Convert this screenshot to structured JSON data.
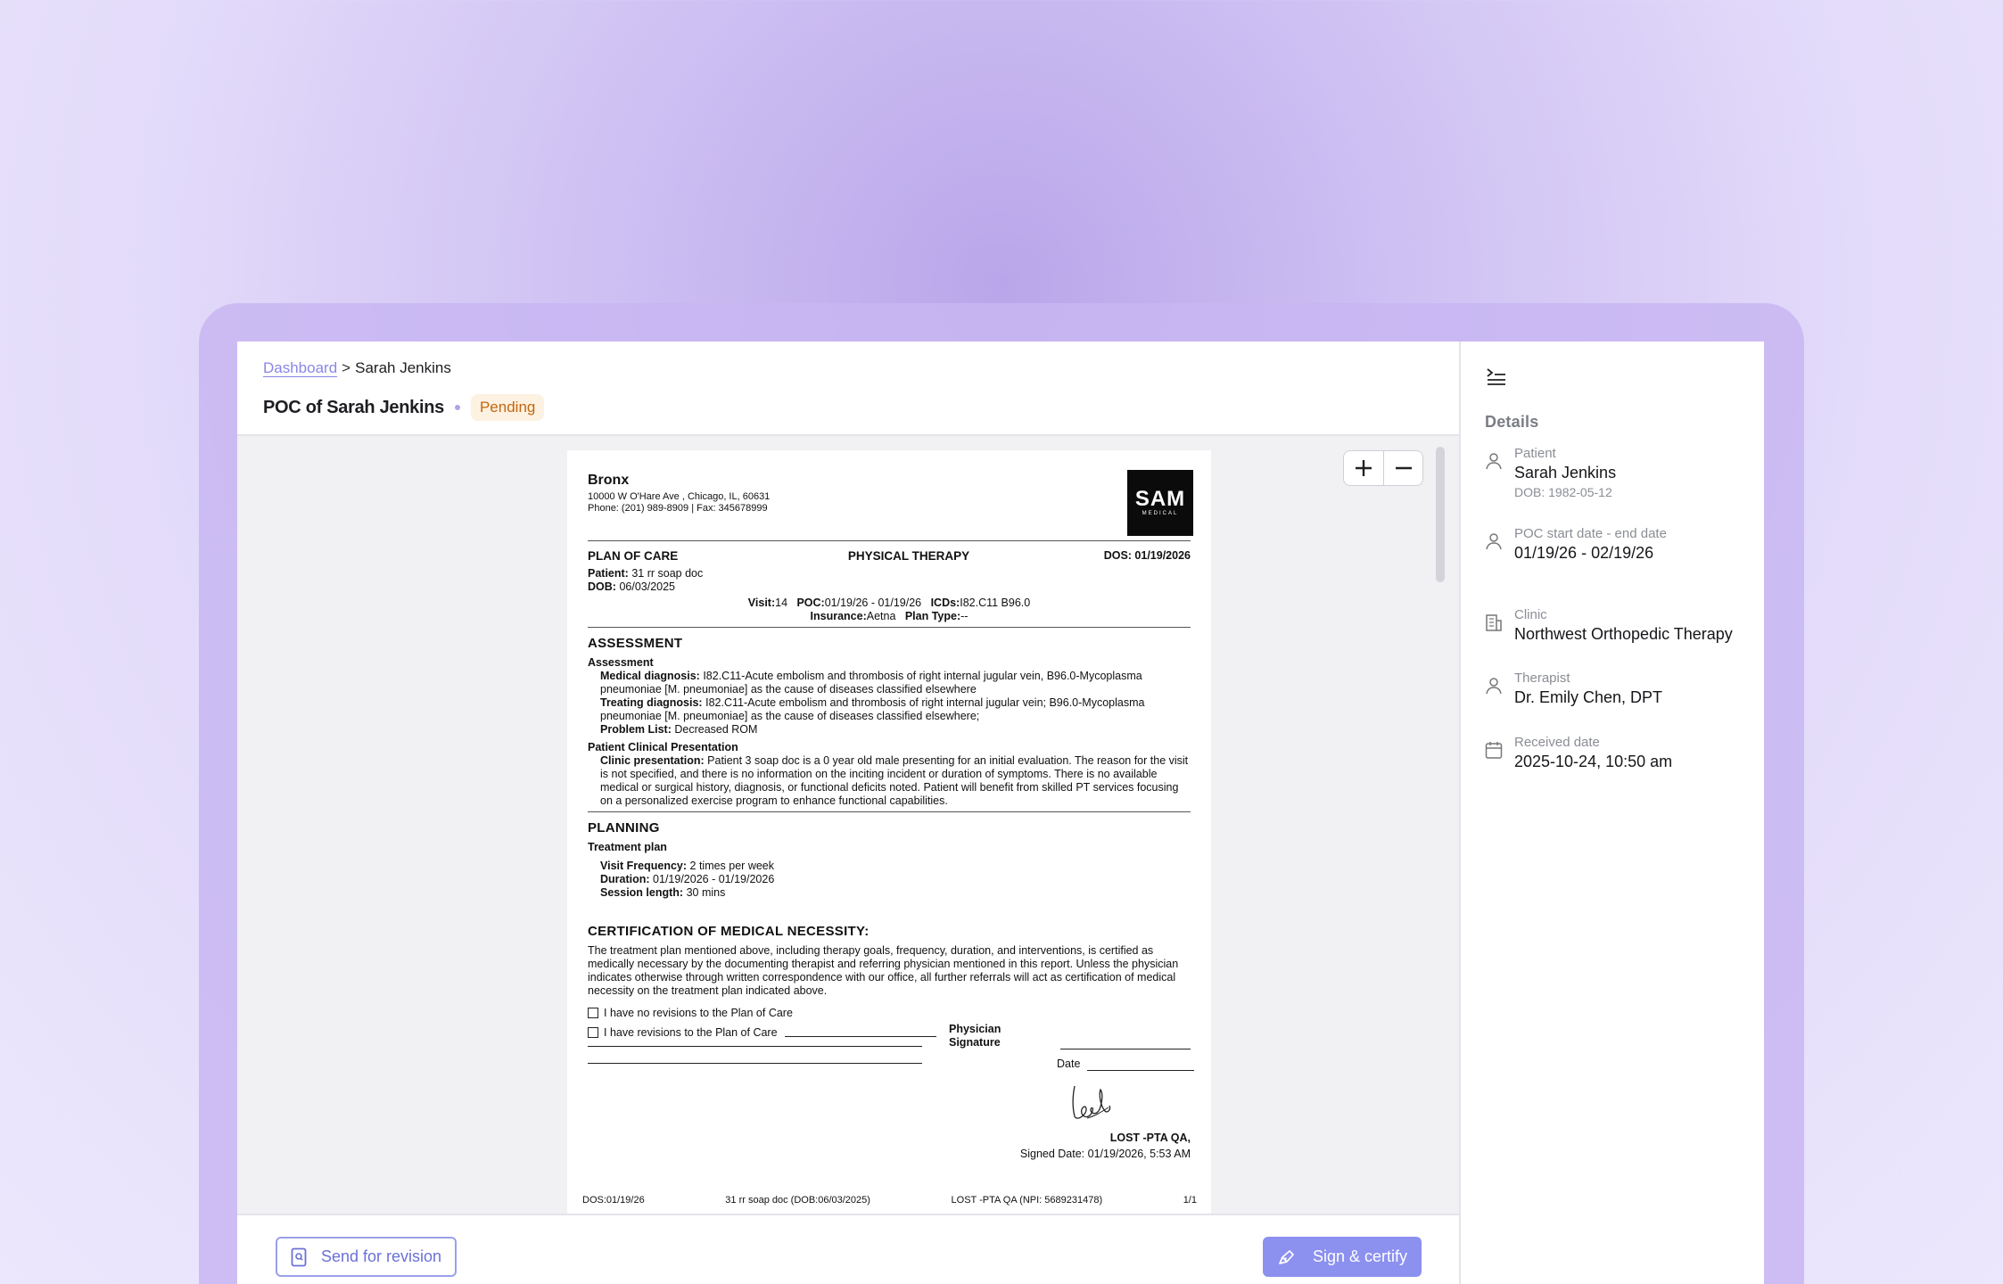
{
  "breadcrumb": {
    "link": "Dashboard",
    "separator": ">",
    "current": "Sarah Jenkins"
  },
  "header": {
    "title": "POC of Sarah Jenkins",
    "status": "Pending"
  },
  "zoom": {
    "in": "+",
    "out": "−"
  },
  "document": {
    "clinic_name": "Bronx",
    "address": "10000 W O'Hare Ave , Chicago, IL, 60631",
    "phone": "Phone: (201) 989-8909 | Fax: 345678999",
    "logo_main": "SAM",
    "logo_sub": "MEDICAL",
    "doc_type": "PLAN OF CARE",
    "discipline": "PHYSICAL THERAPY",
    "dos": "DOS: 01/19/2026",
    "patient_label": "Patient:",
    "patient_value": "31 rr soap doc",
    "dob_label": "DOB:",
    "dob_value": "06/03/2025",
    "visit_label": "Visit:",
    "visit_value": "14",
    "poc_label": "POC:",
    "poc_value": "01/19/26 - 01/19/26",
    "icds_label": "ICDs:",
    "icds_value": "I82.C11 B96.0",
    "insurance_label": "Insurance:",
    "insurance_value": "Aetna",
    "plan_type_label": "Plan Type:",
    "plan_type_value": "--",
    "assessment_section": "ASSESSMENT",
    "assessment_sub": "Assessment",
    "medical_dx_label": "Medical diagnosis:",
    "medical_dx_value": "I82.C11-Acute embolism and thrombosis of right internal jugular vein, B96.0-Mycoplasma pneumoniae [M. pneumoniae] as the cause of diseases classified elsewhere",
    "treating_dx_label": "Treating diagnosis:",
    "treating_dx_value": "I82.C11-Acute embolism and thrombosis of right internal jugular vein; B96.0-Mycoplasma pneumoniae [M. pneumoniae] as the cause of diseases classified elsewhere;",
    "problem_list_label": "Problem List:",
    "problem_list_value": "Decreased ROM",
    "clinical_presentation_sub": "Patient Clinical Presentation",
    "clinic_presentation_label": "Clinic presentation:",
    "clinic_presentation_value": "Patient 3 soap doc is a 0 year old male presenting for an initial evaluation. The reason for the visit is not specified, and there is no information on the inciting incident or duration of symptoms. There is no available medical or surgical history, diagnosis, or functional deficits noted. Patient will benefit from skilled PT services focusing on a personalized exercise program to enhance functional capabilities.",
    "planning_section": "PLANNING",
    "treatment_plan_sub": "Treatment plan",
    "visit_freq_label": "Visit Frequency:",
    "visit_freq_value": "2 times per week",
    "duration_label": "Duration:",
    "duration_value": "01/19/2026 - 01/19/2026",
    "session_label": "Session length:",
    "session_value": "30 mins",
    "certification_section": "CERTIFICATION OF MEDICAL NECESSITY:",
    "certification_text": "The treatment plan mentioned above, including therapy goals, frequency, duration, and interventions, is certified as medically necessary by the documenting therapist and referring physician mentioned in this report. Unless the physician indicates otherwise through written correspondence with our office, all further referrals will act as certification of medical necessity on the treatment plan indicated above.",
    "no_revisions": "I have no revisions to the Plan of Care",
    "has_revisions": "I have revisions to the Plan of Care",
    "physician_signature_label": "Physician Signature",
    "date_label": "Date",
    "signer": "LOST -PTA QA,",
    "signed_date": "Signed Date: 01/19/2026, 5:53 AM",
    "footer_dos": "DOS:01/19/26",
    "footer_patient": "31 rr soap doc (DOB:06/03/2025)",
    "footer_provider": "LOST -PTA QA (NPI: 5689231478)",
    "footer_page": "1/1"
  },
  "actions": {
    "revision": "Send for revision",
    "sign": "Sign & certify"
  },
  "details": {
    "title": "Details",
    "patient_label": "Patient",
    "patient_name": "Sarah Jenkins",
    "patient_dob": "DOB: 1982-05-12",
    "poc_label": "POC start date - end date",
    "poc_value": "01/19/26 - 02/19/26",
    "clinic_label": "Clinic",
    "clinic_value": "Northwest Orthopedic Therapy",
    "therapist_label": "Therapist",
    "therapist_value": "Dr. Emily Chen, DPT",
    "received_label": "Received date",
    "received_value": "2025-10-24, 10:50 am"
  },
  "colors": {
    "accent": "#8c90ef",
    "status_bg": "#fdf1e2",
    "status_fg": "#c4660b",
    "link": "#8a86e6"
  },
  "icons": [
    "collapse-panel-icon",
    "user-icon",
    "building-icon",
    "calendar-icon",
    "document-icon",
    "pen-icon"
  ]
}
